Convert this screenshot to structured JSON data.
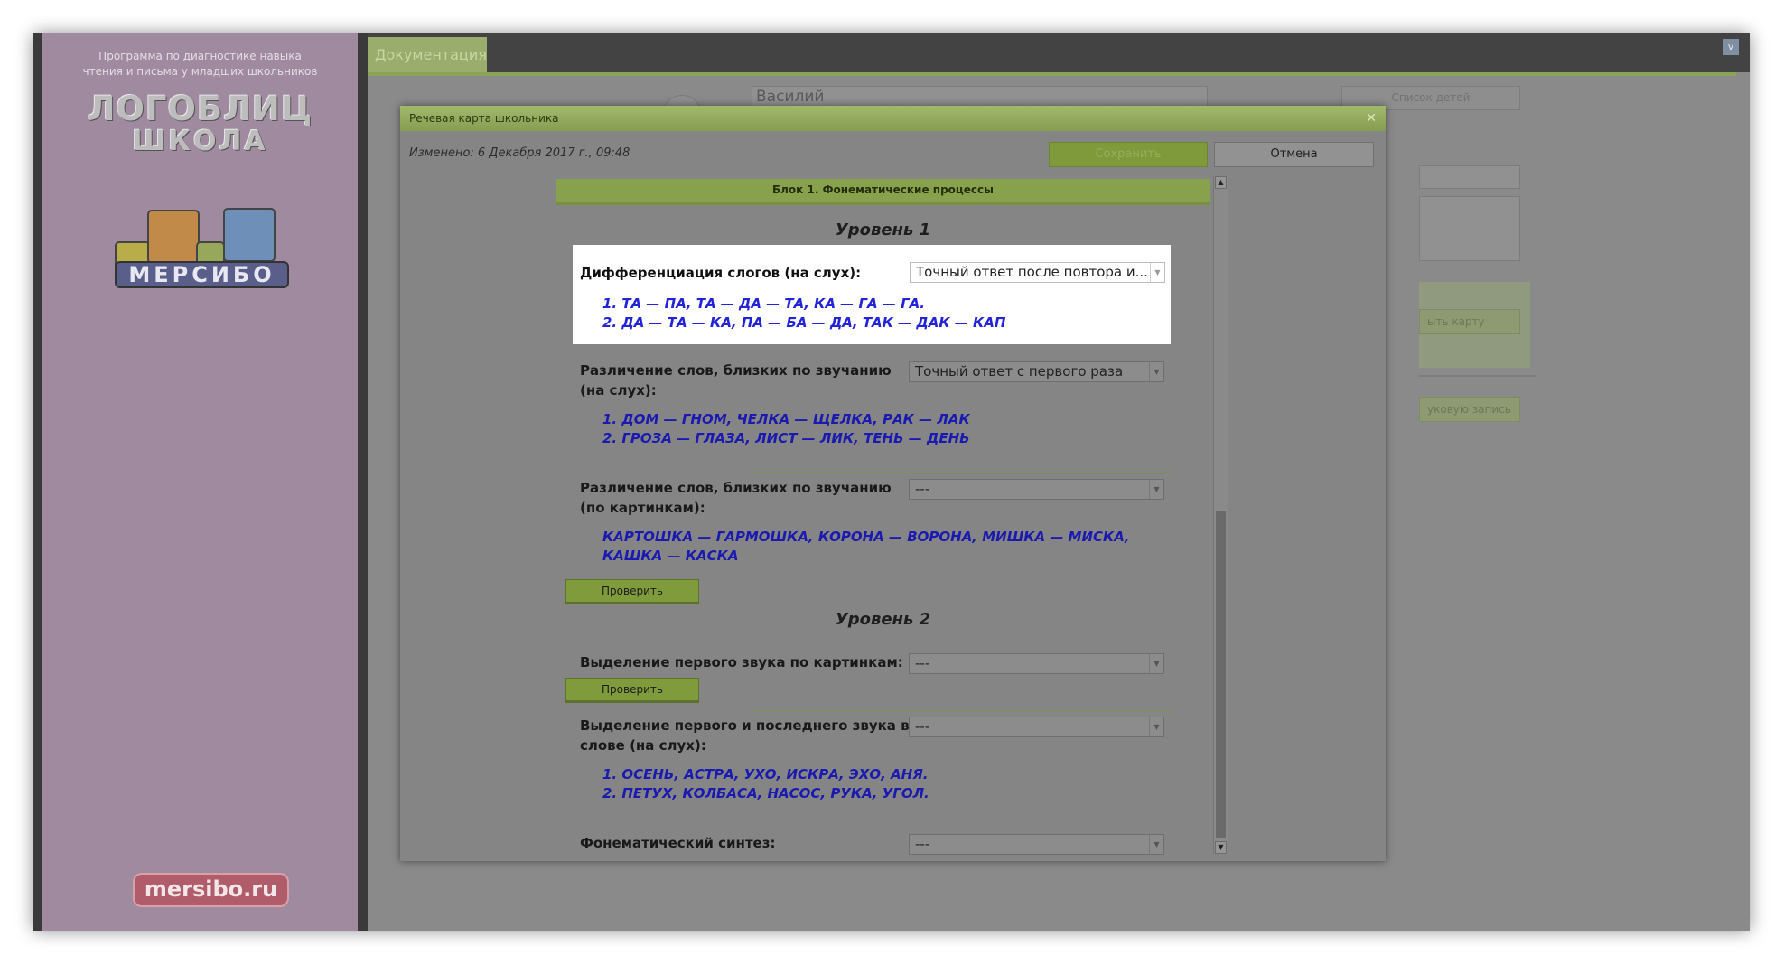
{
  "sidebar": {
    "tagline_line1": "Программа по диагностике навыка",
    "tagline_line2": "чтения и письма у младших школьников",
    "logo_line1": "ЛОГОБЛИЦ",
    "logo_line2": "ШКОЛА",
    "brand": "МЕРСИБО",
    "site": "mersibo.ru"
  },
  "tabs": [
    {
      "label": "Документация"
    }
  ],
  "background": {
    "name_value": "Василий",
    "children_list_btn": "Список детей",
    "card_btn": "ыть карту",
    "record_btn": "уковую запись"
  },
  "modal": {
    "title": "Речевая карта школьника",
    "changed": "Изменено: 6 Декабря 2017 г., 09:48",
    "save": "Сохранить",
    "cancel": "Отмена",
    "block_title": "Блок 1. Фонематические процессы",
    "level1": "Уровень 1",
    "level2": "Уровень 2",
    "check_label": "Проверить",
    "questions": [
      {
        "label": "Дифференциация слогов (на слух):",
        "selected": "Точный ответ после повтора и...",
        "examples": [
          "1. ТА — ПА, ТА — ДА — ТА, КА — ГА — ГА.",
          "2. ДА — ТА — КА, ПА — БА — ДА, ТАК — ДАК — КАП"
        ]
      },
      {
        "label": "Различение слов, близких по звучанию (на слух):",
        "selected": "Точный ответ с первого раза",
        "examples": [
          "1. ДОМ — ГНОМ, ЧЕЛКА — ЩЕЛКА, РАК — ЛАК",
          "2. ГРОЗА — ГЛАЗА, ЛИСТ — ЛИК, ТЕНЬ — ДЕНЬ"
        ]
      },
      {
        "label": "Различение слов, близких по звучанию (по картинкам):",
        "selected": "---",
        "examples": [
          "КАРТОШКА — ГАРМОШКА, КОРОНА — ВОРОНА, МИШКА — МИСКА, КАШКА — КАСКА"
        ]
      },
      {
        "label": "Выделение первого звука по картинкам:",
        "selected": "---",
        "examples": []
      },
      {
        "label": "Выделение первого и последнего звука в слове (на слух):",
        "selected": "---",
        "examples": [
          "1. ОСЕНЬ, АСТРА, УХО, ИСКРА, ЭХО, АНЯ.",
          "2. ПЕТУХ, КОЛБАСА, НАСОС, РУКА, УГОЛ."
        ]
      },
      {
        "label": "Фонематический синтез:",
        "selected": "---",
        "examples": []
      }
    ]
  },
  "colors": {
    "sidebar_bg": "#a08aa0",
    "accent_green": "#88a14c",
    "example_blue": "#2323d8"
  }
}
